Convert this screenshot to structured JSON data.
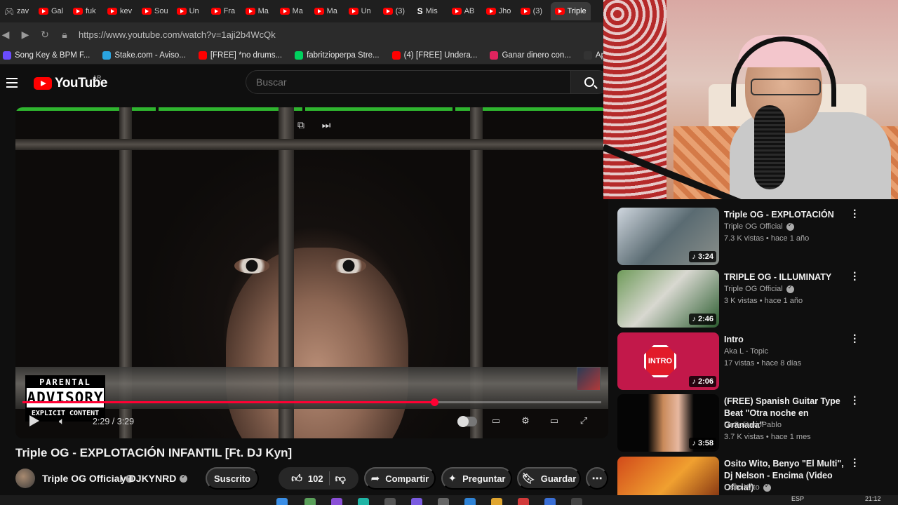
{
  "browser": {
    "tabs": [
      {
        "label": "zav",
        "fav": "gamepad-icon"
      },
      {
        "label": "Gal",
        "fav": "youtube"
      },
      {
        "label": "fuk",
        "fav": "youtube"
      },
      {
        "label": "kev",
        "fav": "youtube"
      },
      {
        "label": "Sou",
        "fav": "youtube"
      },
      {
        "label": "Un",
        "fav": "youtube"
      },
      {
        "label": "Fra",
        "fav": "youtube"
      },
      {
        "label": "Ma",
        "fav": "youtube"
      },
      {
        "label": "Ma",
        "fav": "youtube"
      },
      {
        "label": "Ma",
        "fav": "youtube"
      },
      {
        "label": "Un",
        "fav": "youtube"
      },
      {
        "label": "(3)",
        "fav": "youtube"
      },
      {
        "label": "Mis",
        "fav": "stake"
      },
      {
        "label": "AB",
        "fav": "youtube"
      },
      {
        "label": "Jho",
        "fav": "youtube"
      },
      {
        "label": "(3)",
        "fav": "youtube"
      },
      {
        "label": "Triple",
        "fav": "youtube",
        "active": true
      }
    ],
    "url": "https://www.youtube.com/watch?v=1aji2b4WcQk",
    "bookmarks": [
      {
        "label": "Song Key & BPM F...",
        "color": "#6a4cff"
      },
      {
        "label": "Stake.com - Aviso...",
        "color": "#2aa4e0"
      },
      {
        "label": "[FREE] *no drums...",
        "color": "#ff0000"
      },
      {
        "label": "fabritzioperpa Stre...",
        "color": "#00d15e"
      },
      {
        "label": "(4) [FREE] Undera...",
        "color": "#ff0000"
      },
      {
        "label": "Ganar dinero con...",
        "color": "#e0245e"
      },
      {
        "label": "Apuestas",
        "color": "#333333"
      }
    ]
  },
  "youtube": {
    "logo_text": "YouTube",
    "country": "AR",
    "search_placeholder": "Buscar"
  },
  "player": {
    "time": "2:29 / 3:29",
    "progress": 0.712,
    "advisory": {
      "line1": "PARENTAL",
      "line2": "ADVISORY",
      "line3": "EXPLICIT CONTENT"
    }
  },
  "video": {
    "title": "Triple OG - EXPLOTACIÓN INFANTIL [Ft. DJ Kyn]",
    "channel": "Triple OG Official",
    "collab": "y DJKYNRD",
    "subscribe_label": "Suscrito",
    "likes": "102",
    "share_label": "Compartir",
    "ask_label": "Preguntar",
    "save_label": "Guardar"
  },
  "recommendations": [
    {
      "title": "Triple OG - EXPLOTACIÓN",
      "channel": "Triple OG Official",
      "verified": true,
      "meta": "7.3 K vistas • hace 1 año",
      "duration": "3:24"
    },
    {
      "title": "TRIPLE OG - ILLUMINATY",
      "channel": "Triple OG Official",
      "verified": true,
      "meta": "3 K vistas • hace 1 año",
      "duration": "2:46"
    },
    {
      "title": "Intro",
      "channel": "Aka L - Topic",
      "verified": false,
      "meta": "17 vistas • hace 8 días",
      "duration": "2:06",
      "thumb_text": "INTRO"
    },
    {
      "title": "(FREE) Spanish Guitar Type Beat \"Otra noche en Granada\"",
      "channel": "UnSolitarioPablo",
      "verified": false,
      "meta": "3.7 K vistas • hace 1 mes",
      "duration": "3:58"
    },
    {
      "title": "Osito Wito, Benyo \"El Multi\", Dj Nelson - Encima (Video Oficial)",
      "channel": "Osito Wito",
      "verified": true,
      "meta": "",
      "duration": ""
    }
  ],
  "taskbar": {
    "lang": "ESP",
    "clock": "21:12"
  }
}
